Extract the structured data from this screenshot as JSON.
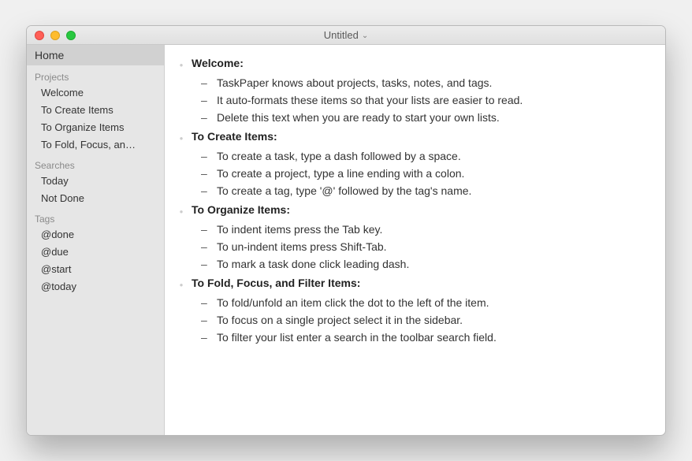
{
  "titlebar": {
    "title": "Untitled",
    "chevron": "⌄"
  },
  "sidebar": {
    "home": "Home",
    "sections": [
      {
        "label": "Projects",
        "items": [
          "Welcome",
          "To Create Items",
          "To Organize Items",
          "To Fold, Focus, an…"
        ]
      },
      {
        "label": "Searches",
        "items": [
          "Today",
          "Not Done"
        ]
      },
      {
        "label": "Tags",
        "items": [
          "@done",
          "@due",
          "@start",
          "@today"
        ]
      }
    ]
  },
  "document": {
    "sections": [
      {
        "heading": "Welcome:",
        "tasks": [
          "TaskPaper knows about projects, tasks, notes, and tags.",
          "It auto-formats these items so that your lists are easier to read.",
          "Delete this text when you are ready to start your own lists."
        ]
      },
      {
        "heading": "To Create Items:",
        "tasks": [
          "To create a task, type a dash followed by a space.",
          "To create a project, type a line ending with a colon.",
          "To create a tag, type '@' followed by the tag's name."
        ]
      },
      {
        "heading": "To Organize Items:",
        "tasks": [
          "To indent items press the Tab key.",
          "To un-indent items press Shift-Tab.",
          "To mark a task done click leading dash."
        ]
      },
      {
        "heading": "To Fold, Focus, and Filter Items:",
        "tasks": [
          "To fold/unfold an item click the dot to the left of the item.",
          "To focus on a single project select it in the sidebar.",
          "To filter your list enter a search in the toolbar search field."
        ]
      }
    ]
  }
}
